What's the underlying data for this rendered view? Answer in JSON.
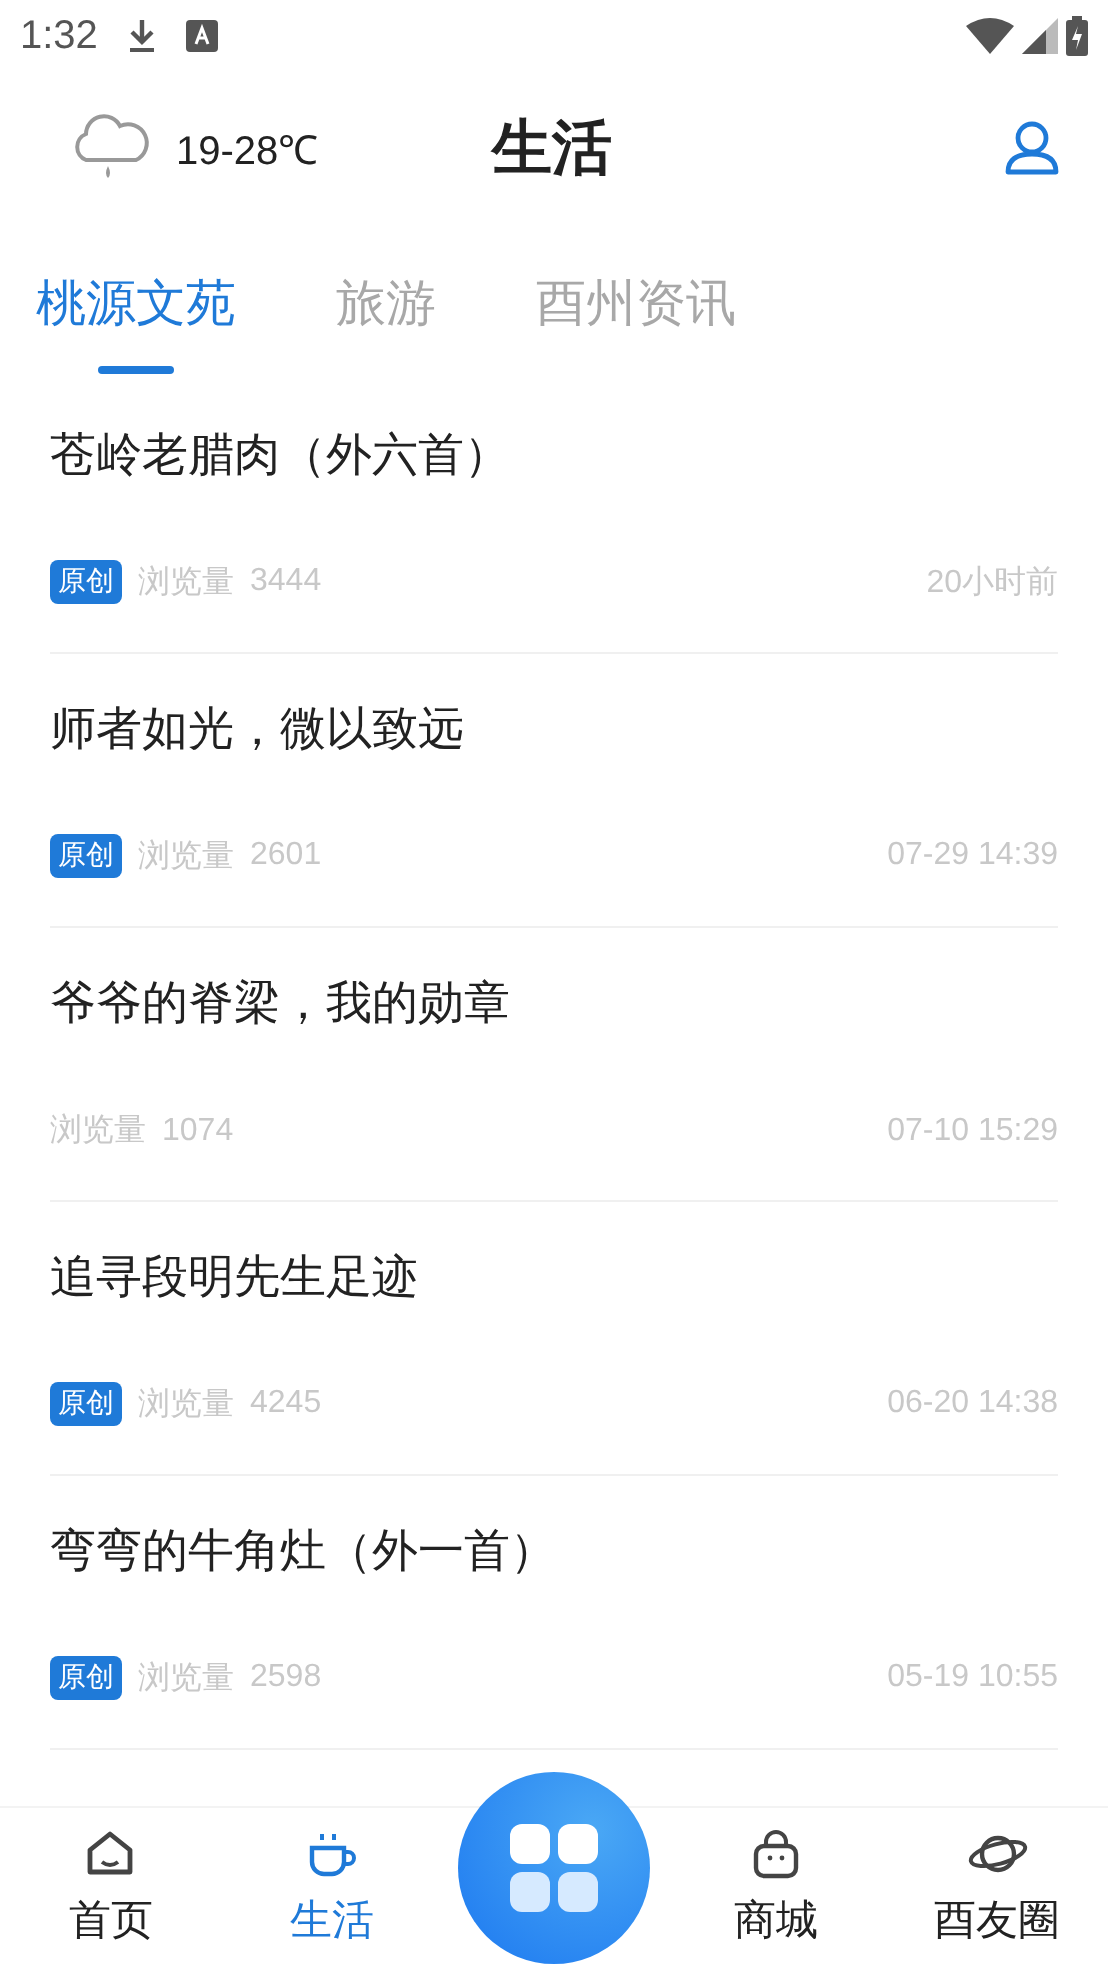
{
  "status_bar": {
    "time": "1:32"
  },
  "header": {
    "temperature": "19-28℃",
    "title": "生活"
  },
  "tabs": [
    {
      "label": "桃源文苑",
      "selected": true
    },
    {
      "label": "旅游",
      "selected": false
    },
    {
      "label": "酉州资讯",
      "selected": false
    }
  ],
  "articles": [
    {
      "title": "苍岭老腊肉（外六首）",
      "original": true,
      "badge": "原创",
      "views_label": "浏览量",
      "views": "3444",
      "time": "20小时前"
    },
    {
      "title": "师者如光，微以致远",
      "original": true,
      "badge": "原创",
      "views_label": "浏览量",
      "views": "2601",
      "time": "07-29 14:39"
    },
    {
      "title": "爷爷的脊梁，我的勋章",
      "original": false,
      "views_label": "浏览量",
      "views": "1074",
      "time": "07-10 15:29"
    },
    {
      "title": "追寻段明先生足迹",
      "original": true,
      "badge": "原创",
      "views_label": "浏览量",
      "views": "4245",
      "time": "06-20 14:38"
    },
    {
      "title": "弯弯的牛角灶（外一首）",
      "original": true,
      "badge": "原创",
      "views_label": "浏览量",
      "views": "2598",
      "time": "05-19 10:55"
    }
  ],
  "bottom_nav": [
    {
      "label": "首页",
      "kind": "home",
      "selected": false
    },
    {
      "label": "生活",
      "kind": "cup",
      "selected": true
    },
    {
      "kind": "center"
    },
    {
      "label": "商城",
      "kind": "bag",
      "selected": false
    },
    {
      "label": "酉友圈",
      "kind": "planet",
      "selected": false
    }
  ]
}
